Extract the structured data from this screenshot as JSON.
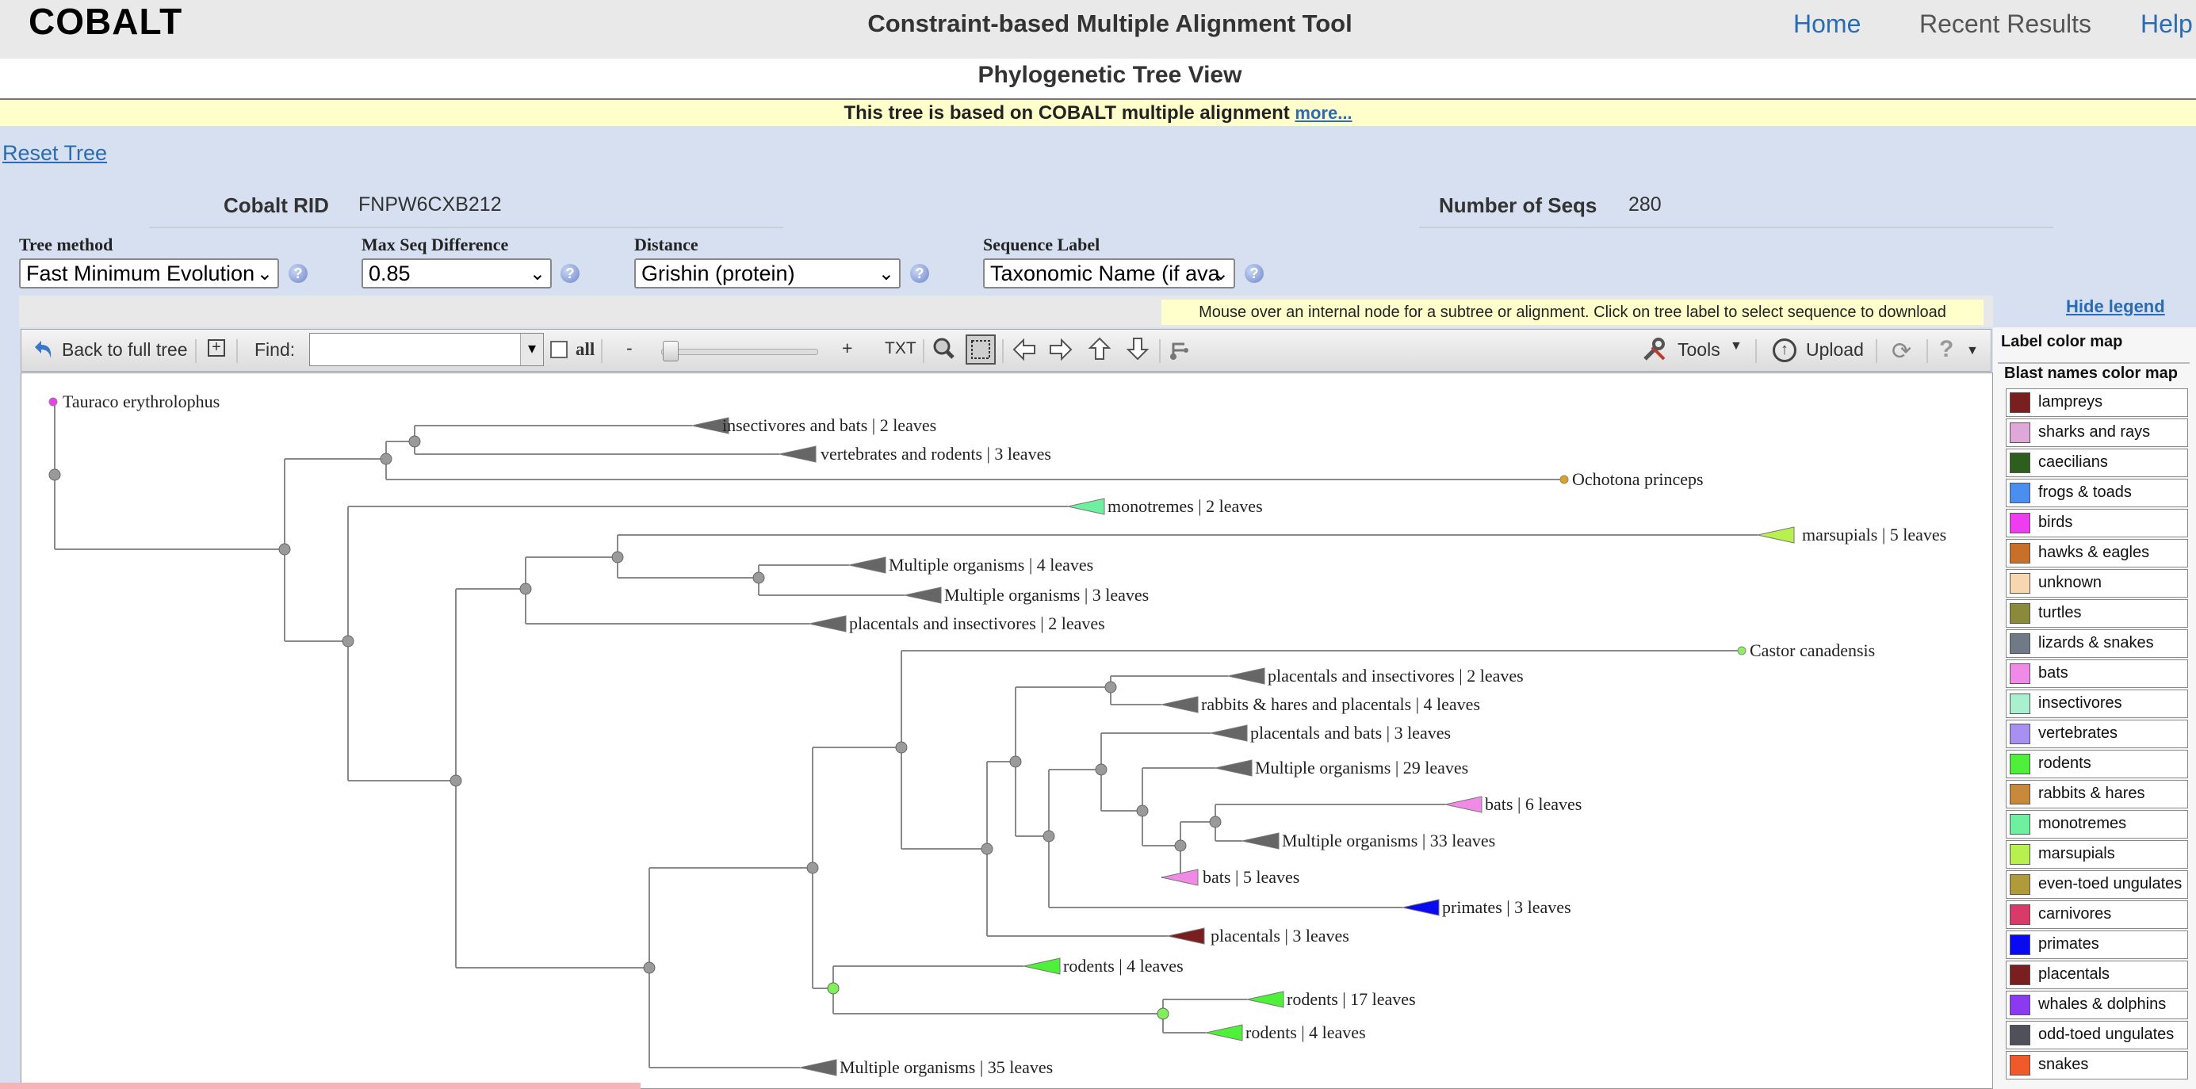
{
  "header": {
    "logo": "COBALT",
    "app_title": "Constraint-based Multiple Alignment Tool",
    "nav": [
      "Home",
      "Recent Results",
      "Help"
    ]
  },
  "page_title": "Phylogenetic Tree View",
  "notice": {
    "text": "This tree is based on COBALT multiple alignment",
    "link": "more..."
  },
  "reset_tree": "Reset Tree",
  "info": {
    "rid_label": "Cobalt RID",
    "rid_value": "FNPW6CXB212",
    "seqs_label": "Number of Seqs",
    "seqs_value": "280"
  },
  "controls": {
    "tree_method": {
      "label": "Tree method",
      "value": "Fast Minimum Evolution"
    },
    "max_seq_diff": {
      "label": "Max Seq Difference",
      "value": "0.85"
    },
    "distance": {
      "label": "Distance",
      "value": "Grishin (protein)"
    },
    "seq_label": {
      "label": "Sequence Label",
      "value": "Taxonomic Name (if ava"
    }
  },
  "mouseover_tip": "Mouse over an internal node for a subtree or alignment. Click on tree label to select sequence to download",
  "toolbar": {
    "back": "Back to full tree",
    "find": "Find:",
    "find_value": "",
    "all": "all",
    "minus": "-",
    "plus": "+",
    "txt": "TXT",
    "tools": "Tools",
    "upload": "Upload"
  },
  "legend": {
    "hide": "Hide legend",
    "label_map": "Label color map",
    "blast_map": "Blast names color map",
    "items": [
      {
        "name": "lampreys",
        "color": "#7a1f1f"
      },
      {
        "name": "sharks and rays",
        "color": "#e0a8d8"
      },
      {
        "name": "caecilians",
        "color": "#2e5e1e"
      },
      {
        "name": "frogs & toads",
        "color": "#4a8ef0"
      },
      {
        "name": "birds",
        "color": "#f03cf0"
      },
      {
        "name": "hawks & eagles",
        "color": "#c8702a"
      },
      {
        "name": "unknown",
        "color": "#f8d6b0"
      },
      {
        "name": "turtles",
        "color": "#8a8a3a"
      },
      {
        "name": "lizards & snakes",
        "color": "#707a86"
      },
      {
        "name": "bats",
        "color": "#f08ae6"
      },
      {
        "name": "insectivores",
        "color": "#a8f0d0"
      },
      {
        "name": "vertebrates",
        "color": "#a890f0"
      },
      {
        "name": "rodents",
        "color": "#4ef03a"
      },
      {
        "name": "rabbits & hares",
        "color": "#c88a3a"
      },
      {
        "name": "monotremes",
        "color": "#6ef0a0"
      },
      {
        "name": "marsupials",
        "color": "#b8f050"
      },
      {
        "name": "even-toed ungulates",
        "color": "#b09a3a"
      },
      {
        "name": "carnivores",
        "color": "#d83a6a"
      },
      {
        "name": "primates",
        "color": "#0a0af0"
      },
      {
        "name": "placentals",
        "color": "#7a1f1f"
      },
      {
        "name": "whales & dolphins",
        "color": "#8a3af0"
      },
      {
        "name": "odd-toed ungulates",
        "color": "#50505a"
      },
      {
        "name": "snakes",
        "color": "#f05a2a"
      }
    ]
  },
  "tree": {
    "leaves": [
      {
        "label": "Tauraco erythrolophus",
        "kind": "leaf",
        "color": "#f03cf0"
      },
      {
        "label": "insectivores and bats | 2 leaves",
        "kind": "collapsed",
        "color": "#666666"
      },
      {
        "label": "vertebrates and rodents | 3 leaves",
        "kind": "collapsed",
        "color": "#666666"
      },
      {
        "label": "Ochotona princeps",
        "kind": "leaf",
        "color": "#e0a020"
      },
      {
        "label": "monotremes | 2 leaves",
        "kind": "collapsed",
        "color": "#6ef0a0"
      },
      {
        "label": "marsupials | 5 leaves",
        "kind": "collapsed",
        "color": "#b8f050"
      },
      {
        "label": "Multiple organisms | 4 leaves",
        "kind": "collapsed",
        "color": "#666666"
      },
      {
        "label": "Multiple organisms | 3 leaves",
        "kind": "collapsed",
        "color": "#666666"
      },
      {
        "label": "placentals and insectivores | 2 leaves",
        "kind": "collapsed",
        "color": "#666666"
      },
      {
        "label": "Castor canadensis",
        "kind": "leaf",
        "color": "#8ef060"
      },
      {
        "label": "placentals and insectivores | 2 leaves",
        "kind": "collapsed",
        "color": "#666666"
      },
      {
        "label": "rabbits & hares and placentals | 4 leaves",
        "kind": "collapsed",
        "color": "#666666"
      },
      {
        "label": "placentals and bats | 3 leaves",
        "kind": "collapsed",
        "color": "#666666"
      },
      {
        "label": "Multiple organisms | 29 leaves",
        "kind": "collapsed",
        "color": "#666666"
      },
      {
        "label": "bats | 6 leaves",
        "kind": "collapsed",
        "color": "#f08ae6"
      },
      {
        "label": "Multiple organisms | 33 leaves",
        "kind": "collapsed",
        "color": "#666666"
      },
      {
        "label": "bats | 5 leaves",
        "kind": "collapsed",
        "color": "#f08ae6"
      },
      {
        "label": "primates | 3 leaves",
        "kind": "collapsed",
        "color": "#0a0af0"
      },
      {
        "label": "placentals | 3 leaves",
        "kind": "collapsed",
        "color": "#7a1f1f"
      },
      {
        "label": "rodents | 4 leaves",
        "kind": "collapsed",
        "color": "#4ef03a"
      },
      {
        "label": "rodents | 17 leaves",
        "kind": "collapsed",
        "color": "#4ef03a"
      },
      {
        "label": "rodents | 4 leaves",
        "kind": "collapsed",
        "color": "#4ef03a"
      },
      {
        "label": "Multiple organisms | 35 leaves",
        "kind": "collapsed",
        "color": "#666666"
      }
    ]
  }
}
